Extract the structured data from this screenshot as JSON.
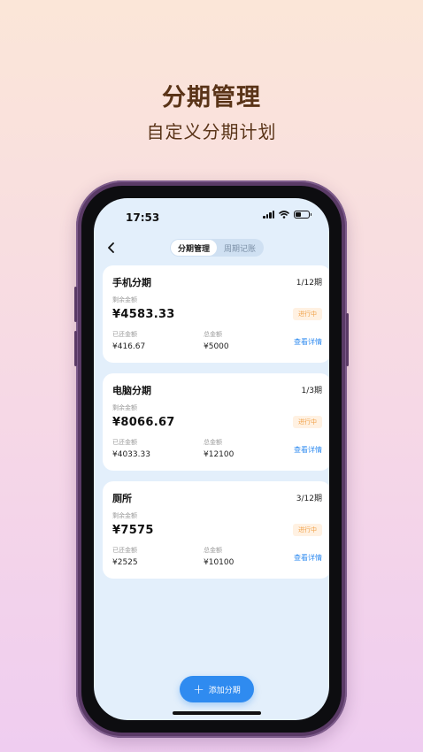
{
  "promo": {
    "title": "分期管理",
    "subtitle": "自定义分期计划"
  },
  "status_bar": {
    "time": "17:53",
    "icons": [
      "signal-icon",
      "wifi-icon",
      "battery-icon"
    ]
  },
  "nav": {
    "back_icon": "chevron-left-icon",
    "tabs": [
      {
        "label": "分期管理",
        "active": true
      },
      {
        "label": "周期记账",
        "active": false
      }
    ]
  },
  "installments": [
    {
      "name": "手机分期",
      "period": "1/12期",
      "remaining_label": "剩余金额",
      "remaining": "¥4583.33",
      "status": "进行中",
      "paid_label": "已还金额",
      "paid": "¥416.67",
      "total_label": "总金额",
      "total": "¥5000",
      "detail": "查看详情"
    },
    {
      "name": "电脑分期",
      "period": "1/3期",
      "remaining_label": "剩余金额",
      "remaining": "¥8066.67",
      "status": "进行中",
      "paid_label": "已还金额",
      "paid": "¥4033.33",
      "total_label": "总金额",
      "total": "¥12100",
      "detail": "查看详情"
    },
    {
      "name": "厕所",
      "period": "3/12期",
      "remaining_label": "剩余金额",
      "remaining": "¥7575",
      "status": "进行中",
      "paid_label": "已还金额",
      "paid": "¥2525",
      "total_label": "总金额",
      "total": "¥10100",
      "detail": "查看详情"
    }
  ],
  "add_button": {
    "icon": "plus-icon",
    "label": "添加分期"
  },
  "colors": {
    "accent": "#2f8bf0",
    "status_text": "#f1a24a",
    "status_bg": "#fff1e2",
    "screen_bg": "#e3effb",
    "promo_text": "#5a3418"
  }
}
